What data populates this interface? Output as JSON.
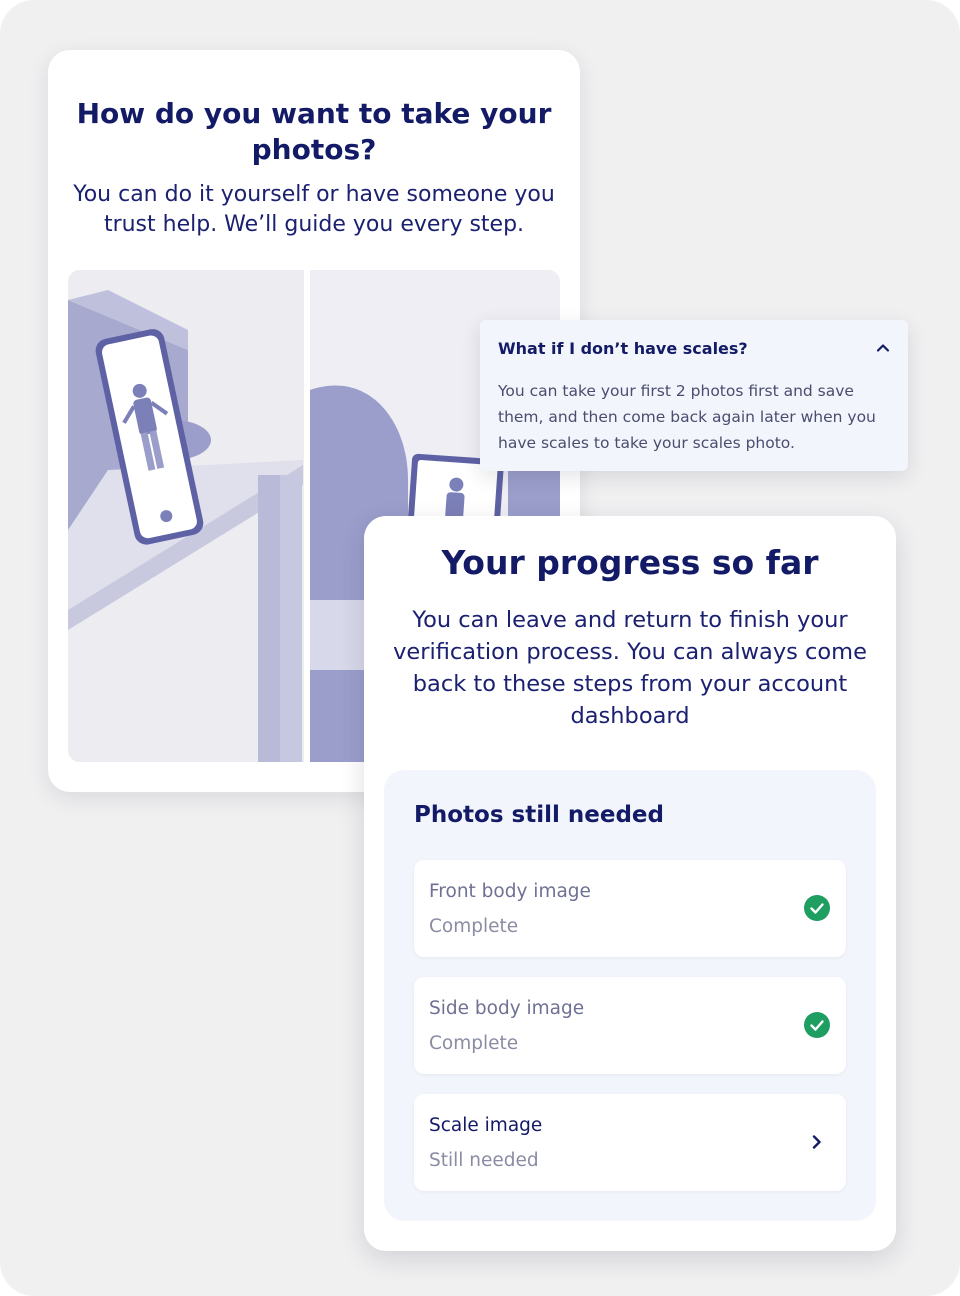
{
  "photos_card": {
    "title": "How do you want to take your photos?",
    "subtitle": "You can do it yourself or have someone you trust help. We’ll guide you every step."
  },
  "faq": {
    "question": "What if I don’t have scales?",
    "answer": "You can take your first 2 photos first and save them, and then come back again later when you have scales to take your scales photo.",
    "expanded": true,
    "icon": "chevron-up-icon"
  },
  "progress_card": {
    "title": "Your progress so far",
    "description": "You can leave and return to finish your verification process. You can always come back to these steps from your account dashboard",
    "panel_title": "Photos still needed",
    "steps": [
      {
        "title": "Front body image",
        "status": "Complete",
        "state": "complete",
        "icon": "check-circle-icon"
      },
      {
        "title": "Side body image",
        "status": "Complete",
        "state": "complete",
        "icon": "check-circle-icon"
      },
      {
        "title": "Scale image",
        "status": "Still needed",
        "state": "needed",
        "icon": "chevron-right-icon"
      }
    ]
  },
  "colors": {
    "navy": "#131a66",
    "success": "#1f9e62",
    "panel_bg": "#f3f5fc",
    "illustration": "#9b9ecb"
  }
}
